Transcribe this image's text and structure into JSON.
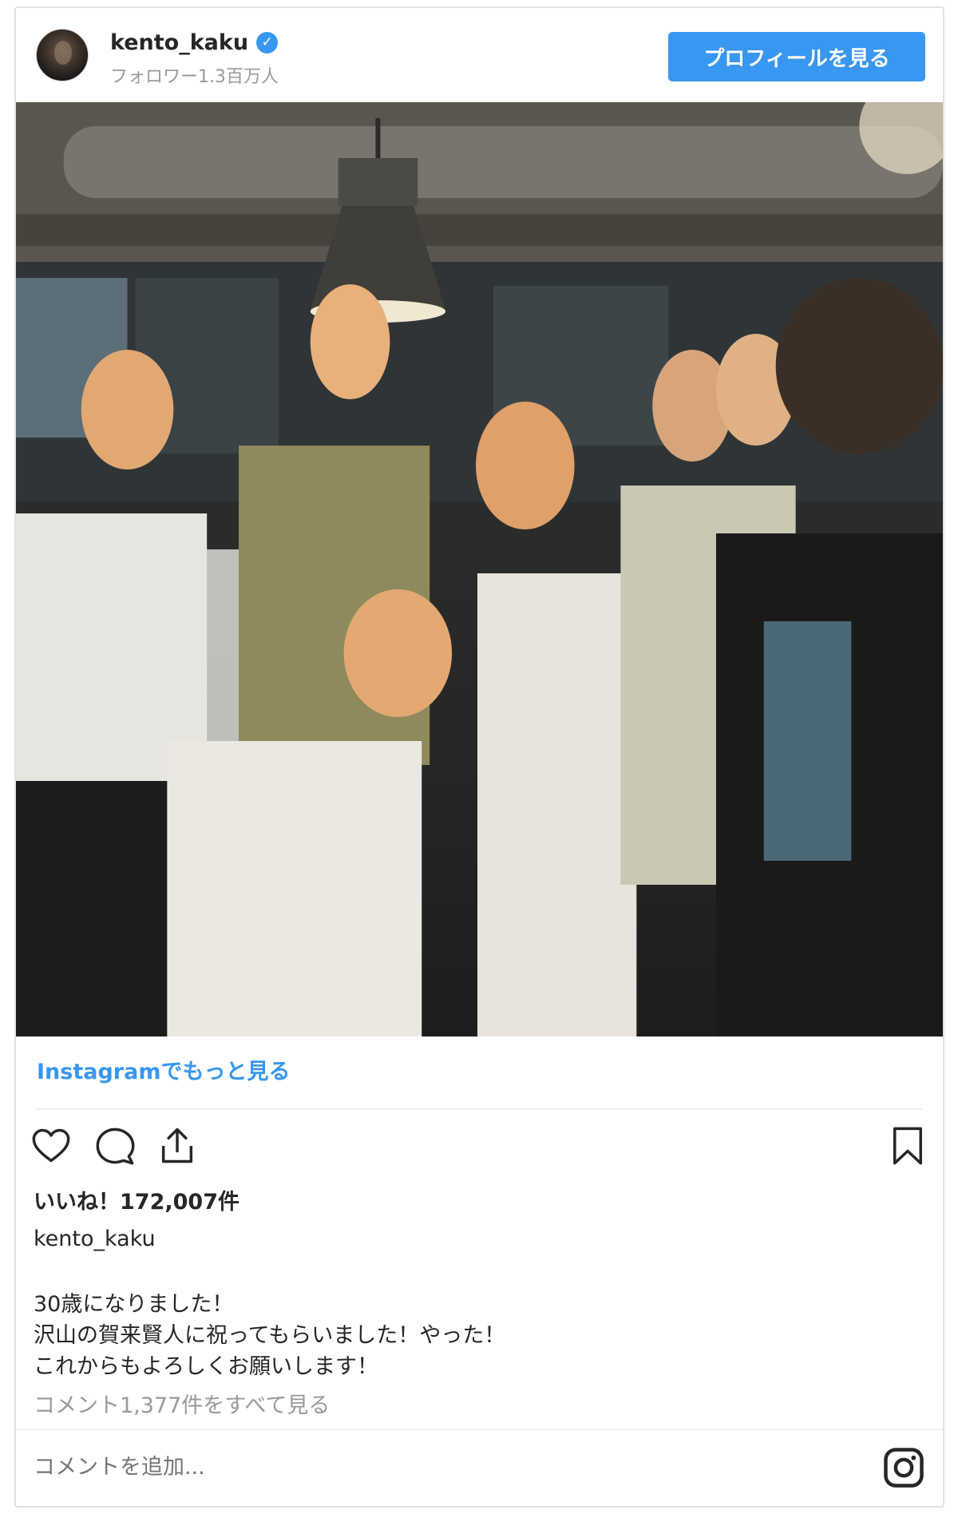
{
  "header": {
    "username": "kento_kaku",
    "verified_icon": "verified-badge-icon",
    "followers": "フォロワー1.3百万人",
    "profile_button": "プロフィールを見る"
  },
  "photo": {
    "alt_icon": "post-photo"
  },
  "more_link": "Instagramでもっと見る",
  "actions": {
    "like_icon": "heart-icon",
    "comment_icon": "comment-icon",
    "share_icon": "share-icon",
    "save_icon": "bookmark-icon"
  },
  "likes": "いいね！172,007件",
  "caption": {
    "username": "kento_kaku",
    "lines": [
      "30歳になりました！",
      "沢山の賀来賢人に祝ってもらいました！やった！",
      "これからもよろしくお願いします！"
    ]
  },
  "view_comments": "コメント1,377件をすべて見る",
  "comment_box": {
    "placeholder": "コメントを追加...",
    "logo_icon": "instagram-icon"
  },
  "colors": {
    "accent": "#3897f0",
    "text": "#262626",
    "muted": "#999999",
    "border": "#efefef"
  }
}
